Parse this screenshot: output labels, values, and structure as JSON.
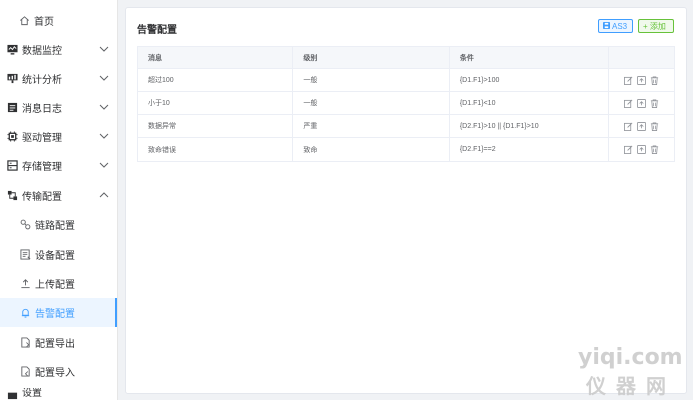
{
  "sidebar": {
    "home": "首页",
    "items": [
      {
        "label": "数据监控",
        "icon": "monitor-icon"
      },
      {
        "label": "统计分析",
        "icon": "chart-icon"
      },
      {
        "label": "消息日志",
        "icon": "log-icon"
      },
      {
        "label": "驱动管理",
        "icon": "chip-icon"
      },
      {
        "label": "存储管理",
        "icon": "storage-icon"
      },
      {
        "label": "传输配置",
        "icon": "transfer-icon"
      }
    ],
    "sub_items": [
      {
        "label": "链路配置",
        "icon": "link-icon"
      },
      {
        "label": "设备配置",
        "icon": "device-icon"
      },
      {
        "label": "上传配置",
        "icon": "upload-icon"
      },
      {
        "label": "告警配置",
        "icon": "alarm-icon",
        "active": true
      },
      {
        "label": "配置导出",
        "icon": "export-icon"
      },
      {
        "label": "配置导入",
        "icon": "import-icon"
      }
    ],
    "partial_last": "设置"
  },
  "main": {
    "title": "告警配置",
    "buttons": {
      "as3": "AS3",
      "add": "+ 添加"
    },
    "table": {
      "headers": [
        "消息",
        "级别",
        "条件",
        ""
      ],
      "rows": [
        {
          "message": "超过100",
          "level": "一般",
          "condition": "{D1.F1}>100"
        },
        {
          "message": "小于10",
          "level": "一般",
          "condition": "{D1.F1}<10"
        },
        {
          "message": "数据异常",
          "level": "严重",
          "condition": "{D2.F1}>10 || {D1.F1}>10"
        },
        {
          "message": "致命错误",
          "level": "致命",
          "condition": "{D2.F1}==2"
        }
      ]
    }
  },
  "watermark": {
    "top": "yiqi.com",
    "bottom": "仪器网"
  },
  "colors": {
    "accent": "#409eff",
    "success": "#67c23a",
    "active_bg": "#ecf5ff"
  }
}
